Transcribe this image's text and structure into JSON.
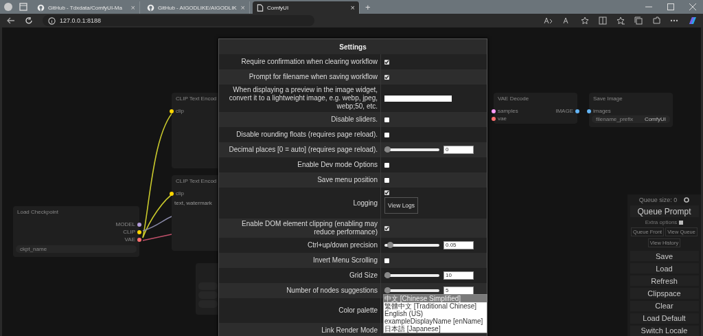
{
  "browser": {
    "tabs": [
      {
        "title": "GitHub - Tdxdata/ComfyUI-Ma",
        "kind": "github",
        "selected": false,
        "close": "×"
      },
      {
        "title": "GitHub - AIGODLIKE/AIGODLIK",
        "kind": "github",
        "selected": false,
        "close": "×"
      },
      {
        "title": "ComfyUI",
        "kind": "page",
        "selected": true,
        "close": "×"
      }
    ],
    "new_tab": "+",
    "address": "127.0.0.1:8188"
  },
  "nodes": [
    {
      "title": "Load Checkpoint",
      "outputs": [
        {
          "name": "MODEL",
          "color": "#b39ddb"
        },
        {
          "name": "CLIP",
          "color": "#ffd500"
        },
        {
          "name": "VAE",
          "color": "#ff6e6e"
        }
      ],
      "widgets": [
        {
          "name": "ckpt_name"
        }
      ]
    },
    {
      "title": "CLIP Text Encod",
      "inputs": [
        {
          "name": "clip",
          "color": "#ffd500"
        }
      ]
    },
    {
      "title": "CLIP Text Encod",
      "inputs": [
        {
          "name": "clip",
          "color": "#ffd500"
        }
      ],
      "text": "text, watermark"
    },
    {
      "kind": "partial"
    },
    {
      "title": "VAE Decode",
      "inputs": [
        {
          "name": "samples",
          "color": "#ff9cf9"
        },
        {
          "name": "vae",
          "color": "#ff6e6e"
        }
      ],
      "outputs": [
        {
          "name": "IMAGE",
          "color": "#64b5f6"
        }
      ]
    },
    {
      "title": "Save Image",
      "inputs": [
        {
          "name": "images",
          "color": "#64b5f6"
        }
      ],
      "widgets": [
        {
          "name": "filename_prefix",
          "value": "ComfyUI"
        }
      ]
    }
  ],
  "settings": {
    "title": "Settings",
    "rows": [
      {
        "kind": "checkbox",
        "label": "Require confirmation when clearing workflow",
        "checked": true
      },
      {
        "kind": "checkbox",
        "label": "Prompt for filename when saving workflow",
        "checked": true
      },
      {
        "kind": "text",
        "label": "When displaying a preview in the image widget, convert it to a lightweight image, e.g. webp, jpeg, webp;50, etc."
      },
      {
        "kind": "checkbox",
        "label": "Disable sliders.",
        "checked": false
      },
      {
        "kind": "checkbox",
        "label": "Disable rounding floats (requires page reload).",
        "checked": false
      },
      {
        "kind": "slider",
        "label": "Decimal places [0 = auto] (requires page reload).",
        "level": 0,
        "value": "0"
      },
      {
        "kind": "checkbox",
        "label": "Enable Dev mode Options",
        "checked": false
      },
      {
        "kind": "checkbox",
        "label": "Save menu position",
        "checked": false
      },
      {
        "kind": "logging",
        "label": "Logging",
        "checked": true,
        "button": "View Logs"
      },
      {
        "kind": "checkbox",
        "label": "Enable DOM element clipping (enabling may reduce performance)",
        "checked": true
      },
      {
        "kind": "slider",
        "label": "Ctrl+up/down precision",
        "level": 0.05,
        "value": "0.05"
      },
      {
        "kind": "checkbox",
        "label": "Invert Menu Scrolling",
        "checked": false
      },
      {
        "kind": "slider",
        "label": "Grid Size",
        "level": 0,
        "value": "10"
      },
      {
        "kind": "slider",
        "label": "Number of nodes suggestions",
        "level": 0,
        "value": "5"
      },
      {
        "kind": "list",
        "label": "Color palette",
        "options": [
          {
            "label": "中文 [Chinese Simplified]",
            "selected": true
          },
          {
            "label": "繁體中文 [Traditional Chinese]",
            "selected": false
          },
          {
            "label": "English (US)",
            "selected": false
          },
          {
            "label": "exampleDisplayName [enName]",
            "selected": false
          },
          {
            "label": "日本語 [Japanese]",
            "selected": false
          }
        ]
      },
      {
        "kind": "label",
        "label": "Link Render Mode"
      }
    ]
  },
  "queue_panel": {
    "title": "Queue size: 0",
    "primary": "Queue Prompt",
    "extra_options": {
      "label": "Extra options",
      "checked": false
    },
    "small_buttons": [
      "Queue Front",
      "View Queue"
    ],
    "history": "View History",
    "buttons": [
      "Save",
      "Load",
      "Refresh",
      "Clipspace",
      "Clear",
      "Load Default",
      "Switch Locale"
    ]
  }
}
